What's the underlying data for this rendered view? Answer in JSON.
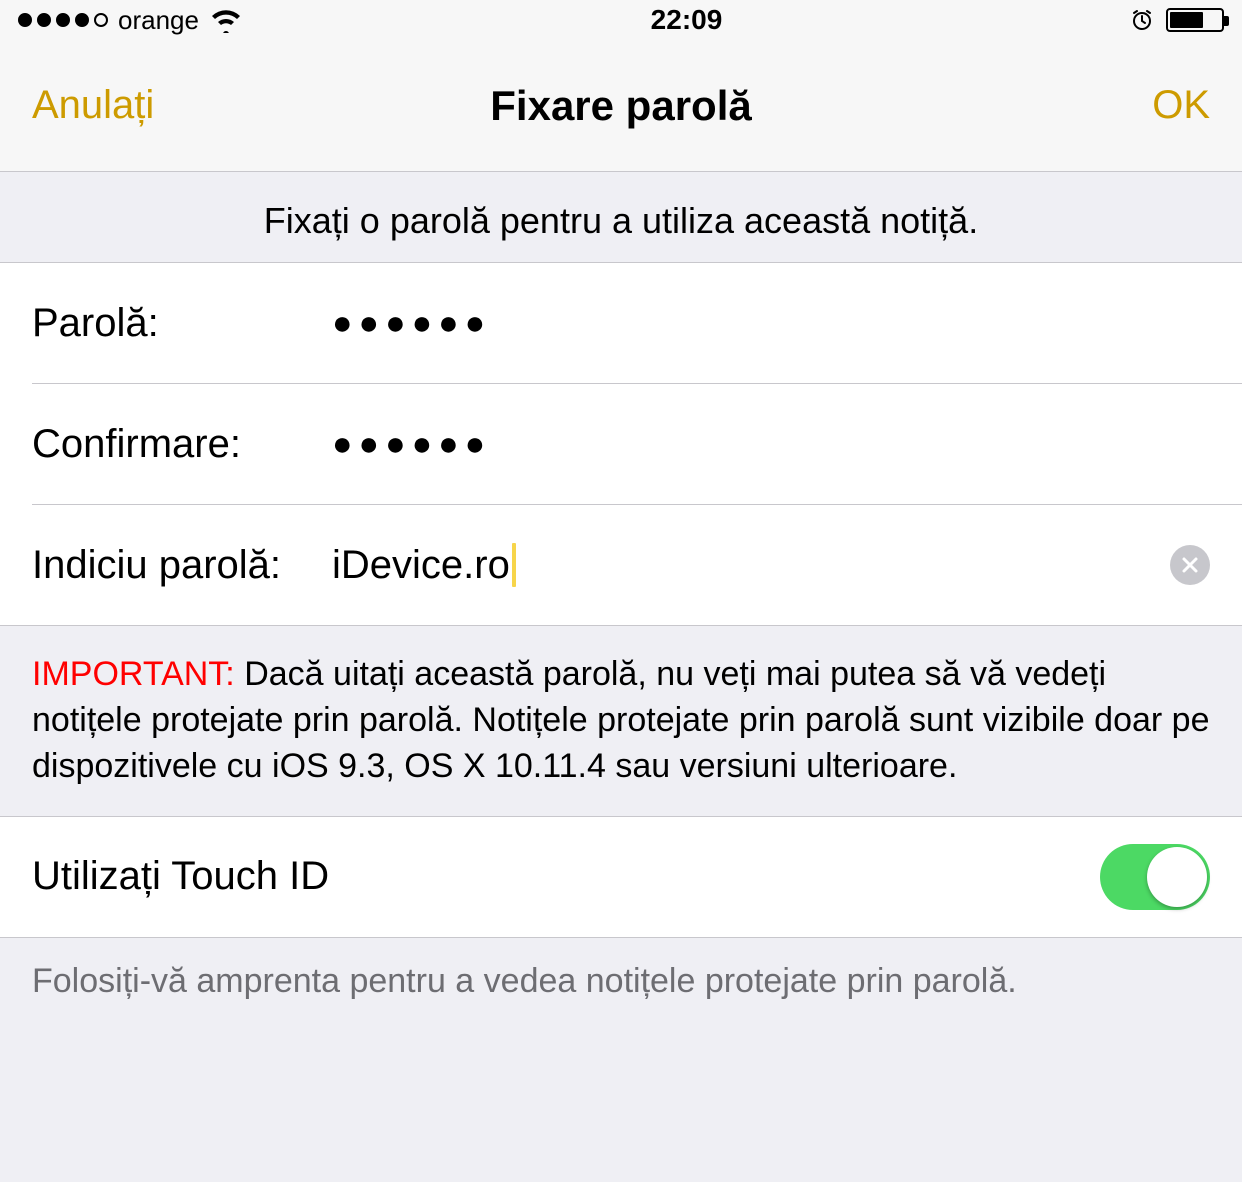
{
  "status": {
    "carrier": "orange",
    "time": "22:09"
  },
  "nav": {
    "cancel": "Anulați",
    "title": "Fixare parolă",
    "done": "OK"
  },
  "header": "Fixați o parolă pentru a utiliza această notiță.",
  "fields": {
    "password_label": "Parolă:",
    "password_value": "●●●●●●",
    "confirm_label": "Confirmare:",
    "confirm_value": "●●●●●●",
    "hint_label": "Indiciu parolă:",
    "hint_value": "iDevice.ro"
  },
  "important": {
    "prefix": "IMPORTANT:",
    "text": " Dacă uitați această parolă, nu veți mai putea să vă vedeți notițele protejate prin parolă. Notițele protejate prin parolă sunt vizibile doar pe dispozitivele cu iOS 9.3, OS X 10.11.4 sau versiuni ulterioare."
  },
  "touchid": {
    "label": "Utilizați Touch ID",
    "on": true
  },
  "touchid_footer": "Folosiți-vă amprenta pentru a vedea notițele protejate prin parolă."
}
